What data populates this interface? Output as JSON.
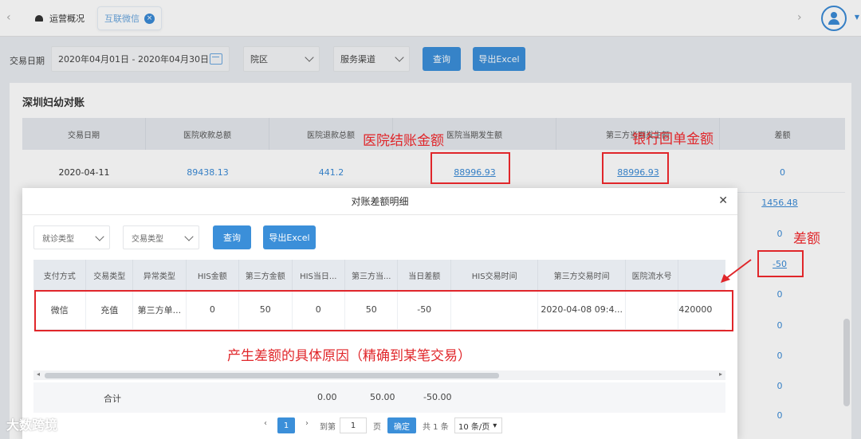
{
  "tabs": [
    {
      "label": "运营概况"
    },
    {
      "label": "互联微信"
    }
  ],
  "filters": {
    "date_label": "交易日期",
    "date_value": "2020年04月01日 - 2020年04月30日",
    "campus_label": "院区",
    "channel_label": "服务渠道",
    "query_label": "查询",
    "export_label": "导出Excel"
  },
  "panel": {
    "title": "深圳妇幼对账",
    "columns": [
      "交易日期",
      "医院收款总额",
      "医院退款总额",
      "医院当期发生额",
      "第三方当期发生额",
      "差额"
    ],
    "row": {
      "date": "2020-04-11",
      "receipt": "89438.13",
      "refund": "441.2",
      "hospital_amount": "88996.93",
      "third_amount": "88996.93",
      "diff": "0"
    },
    "diff_column_values": [
      "1456.48",
      "0",
      "-50",
      "0",
      "0",
      "0",
      "0",
      "0"
    ]
  },
  "modal": {
    "title": "对账差额明细",
    "visit_type": "就诊类型",
    "trade_type": "交易类型",
    "query_label": "查询",
    "export_label": "导出Excel",
    "columns": [
      "支付方式",
      "交易类型",
      "异常类型",
      "HIS金额",
      "第三方金额",
      "HIS当日...",
      "第三方当...",
      "当日差额",
      "HIS交易时间",
      "第三方交易时间",
      "医院流水号"
    ],
    "row": [
      "微信",
      "充值",
      "第三方单...",
      "0",
      "50",
      "0",
      "50",
      "-50",
      "",
      "2020-04-08 09:4...",
      "",
      "420000"
    ],
    "summary": {
      "label": "合计",
      "v1": "0.00",
      "v2": "50.00",
      "v3": "-50.00"
    },
    "pager": {
      "current": "1",
      "goto": "到第",
      "page_input": "1",
      "page_unit": "页",
      "confirm": "确定",
      "total": "共 1 条",
      "page_size": "10 条/页"
    }
  },
  "annotations": {
    "hospital": "医院结账金额",
    "bank": "银行回单金额",
    "diff": "差额",
    "reason": "产生差额的具体原因（精确到某笔交易）"
  },
  "watermark": "大数跨境",
  "colors": {
    "accent": "#3b8fd9",
    "annotation": "#e0262a"
  }
}
